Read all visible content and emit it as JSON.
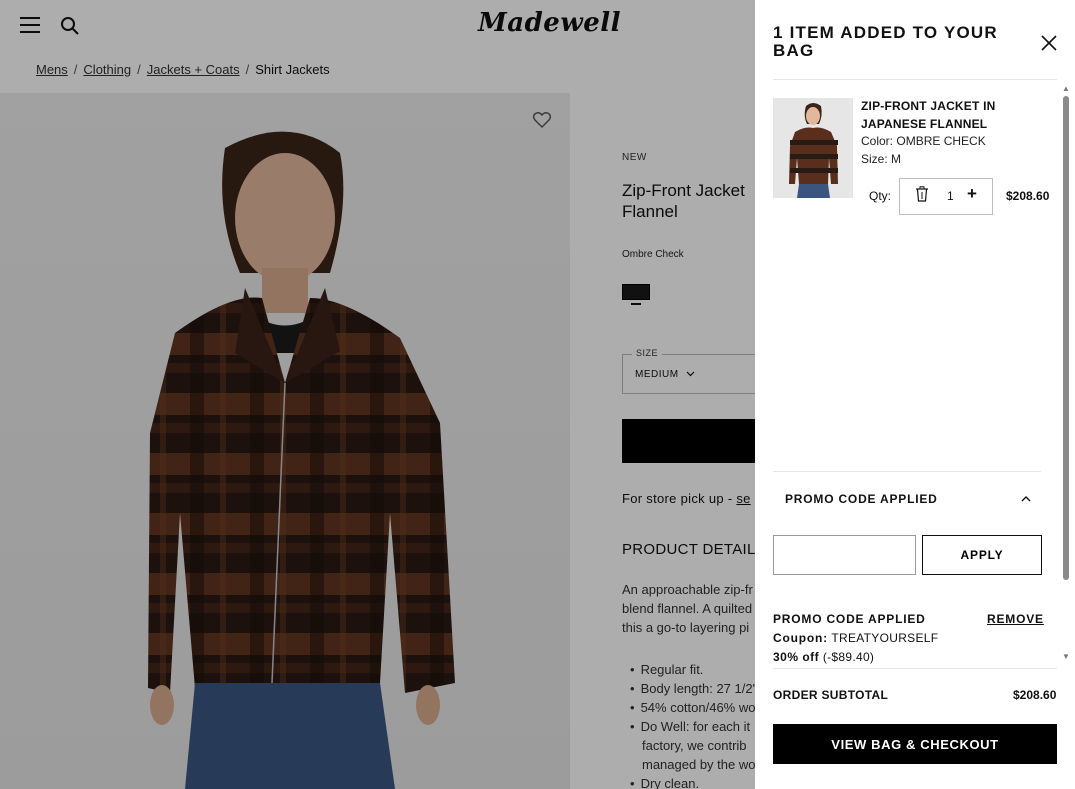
{
  "header": {
    "logo_text": "Madewell"
  },
  "breadcrumb": {
    "items": [
      "Mens",
      "Clothing",
      "Jackets + Coats"
    ],
    "separator": "/",
    "current": "Shirt Jackets"
  },
  "product": {
    "badge": "NEW",
    "title": "Zip-Front Jacket Flannel",
    "color_name": "Ombre Check",
    "swatch_color": "#1a1a1a",
    "size_label": "SIZE",
    "size_value": "MEDIUM",
    "pickup_text": "For store pick up - ",
    "pickup_link": "se",
    "details_heading": "PRODUCT DETAILS",
    "details_lines": [
      "An approachable zip-fr",
      "blend flannel. A quilted",
      "this a go-to layering pi"
    ],
    "bullets": [
      "Regular fit.",
      "Body length: 27 1/2\"",
      "54% cotton/46% wo",
      "Do Well: for each it",
      "factory, we contrib",
      "managed by the wo",
      "Dry clean."
    ]
  },
  "drawer": {
    "title": "1 ITEM ADDED TO YOUR BAG",
    "item": {
      "name": "ZIP-FRONT JACKET IN JAPANESE FLANNEL",
      "color_label": "Color:",
      "color_value": "OMBRE CHECK",
      "size_label": "Size:",
      "size_value": "M",
      "qty_label": "Qty:",
      "qty_value": "1",
      "qty_plus": "+",
      "price": "$208.60"
    },
    "promo": {
      "header": "PROMO CODE APPLIED",
      "input_value": "",
      "input_placeholder": "",
      "apply_label": "APPLY",
      "applied_label": "PROMO CODE APPLIED",
      "remove_label": "REMOVE",
      "coupon_label": "Coupon:",
      "coupon_code": "TREATYOURSELF",
      "discount_label": "30% off",
      "discount_amount": "(-$89.40)"
    },
    "subtotal_label": "ORDER SUBTOTAL",
    "subtotal_value": "$208.60",
    "checkout_label": "VIEW BAG & CHECKOUT"
  },
  "colors": {
    "overlay": "rgba(0,0,0,0.32)",
    "primary_button": "#000000",
    "jacket_dark": "#2a1a14",
    "jacket_rust": "#6b3a22"
  }
}
